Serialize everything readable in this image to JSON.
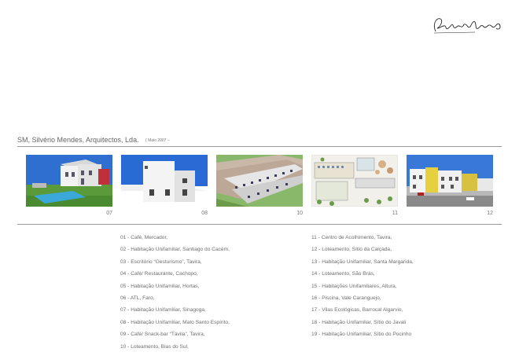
{
  "header": {
    "title": "SM, Silvério Mendes, Arquitectos, Lda.",
    "date": "( Maio 2007 –"
  },
  "thumbnails": [
    {
      "number": "07"
    },
    {
      "number": "08"
    },
    {
      "number": "10"
    },
    {
      "number": "11"
    },
    {
      "number": "12"
    }
  ],
  "projects_left": [
    "01 - Café, Mercador,",
    "02 - Habitação Unifamiliar, Santiago do Cacém,",
    "03 - Escritório “Gesturismo”, Tavira,",
    "04 - Café/ Restaurante, Cachopo,",
    "05 - Habitação Unifamiliar, Hortas,",
    "06 - ATL, Faro,",
    "07 - Habitação Unifamiliar, Sinagoga,",
    "08 - Habitação Unifamiliar, Mato Santo Espírito,",
    "09 - Café/ Snack-bar “Távila”, Tavira,",
    "10 - Loteamento, Bias do Sul,"
  ],
  "projects_right": [
    "11 - Centro de Acolhimento, Tavira,",
    "12 - Loteamento, Sítio da Calçada,",
    "13 - Habitação Unifamiliar, Santa Margarida,",
    "14 - Loteamento, São Brás,",
    "15 - Habitações Unifamiliares, Altura,",
    "16 - Piscina, Vale Caranguejo,",
    "17 - Vilas Ecológicas, Barrocal Algarvio,",
    "18 - Habitação Unifamiliar, Sítio do Javali",
    "19 - Habitação Unifamiliar, Sítio do Pocinho"
  ],
  "colors": {
    "rule": "#9a9a9a",
    "text": "#6e6e6e",
    "sky": "#2f6fd0"
  }
}
